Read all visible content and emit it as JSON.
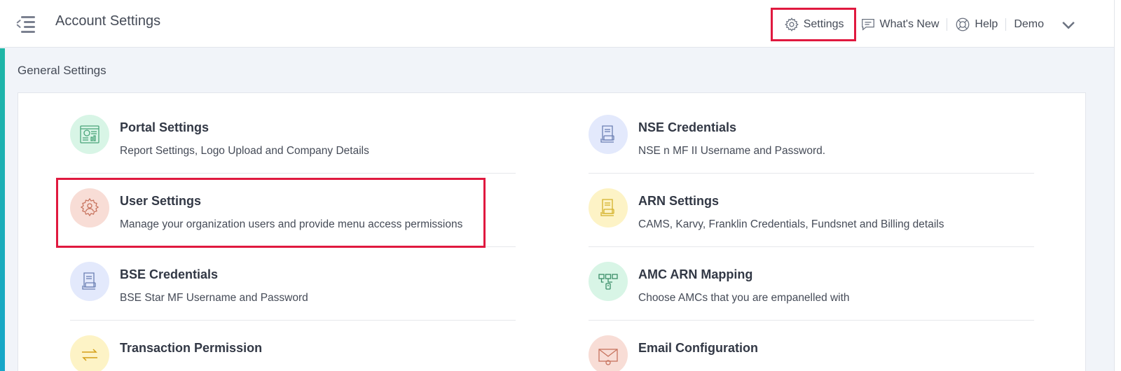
{
  "header": {
    "title": "Account Settings",
    "nav": [
      {
        "label": "Settings",
        "icon": "gear-icon"
      },
      {
        "label": "What's New",
        "icon": "chat-icon"
      },
      {
        "label": "Help",
        "icon": "lifebuoy-icon"
      },
      {
        "label": "Demo",
        "icon": "chevron-down-icon"
      }
    ]
  },
  "section": {
    "title": "General Settings"
  },
  "settings": [
    {
      "title": "Portal Settings",
      "desc": "Report Settings, Logo Upload and Company Details",
      "icon": "dashboard-icon",
      "color": "#d8f5e6"
    },
    {
      "title": "NSE Credentials",
      "desc": "NSE n MF II Username and Password.",
      "icon": "document-nse-icon",
      "color": "#e3e9fc"
    },
    {
      "title": "User Settings",
      "desc": "Manage your organization users and provide menu access permissions",
      "icon": "user-gear-icon",
      "color": "#f8ddd6"
    },
    {
      "title": "ARN Settings",
      "desc": "CAMS, Karvy, Franklin Credentials, Fundsnet and Billing details",
      "icon": "document-arn-icon",
      "color": "#fdf3c6"
    },
    {
      "title": "BSE Credentials",
      "desc": "BSE Star MF Username and Password",
      "icon": "document-bse-icon",
      "color": "#e3e9fc"
    },
    {
      "title": "AMC ARN Mapping",
      "desc": "Choose AMCs that you are empanelled with",
      "icon": "mapping-icon",
      "color": "#d8f5e6"
    },
    {
      "title": "Transaction Permission",
      "desc": "",
      "icon": "transfer-arrows-icon",
      "color": "#fdf3c6"
    },
    {
      "title": "Email Configuration",
      "desc": "",
      "icon": "envelope-gear-icon",
      "color": "#f8ddd6"
    }
  ],
  "colors": {
    "accent_highlight": "#e0193f",
    "sidebar_accent": "#1fb6a6"
  }
}
